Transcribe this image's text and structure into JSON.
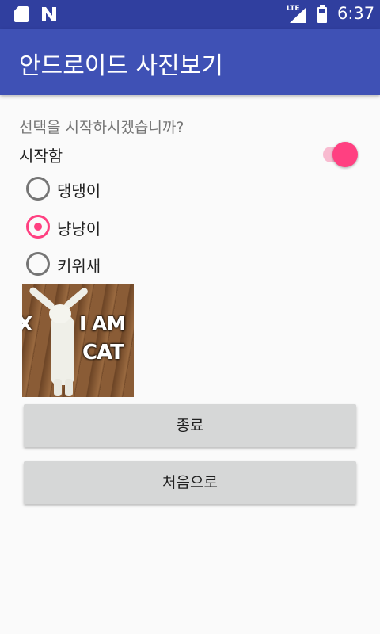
{
  "status_bar": {
    "time": "6:37",
    "network_label": "LTE",
    "icons": [
      "sd-card-icon",
      "n-notification-icon",
      "lte-signal-icon",
      "battery-icon"
    ]
  },
  "app_bar": {
    "title": "안드로이드 사진보기",
    "color": "#3f51b5",
    "status_color": "#303f9f"
  },
  "main": {
    "question": "선택을 시작하시겠습니까?",
    "switch": {
      "label": "시작함",
      "checked": true,
      "accent": "#ff4081"
    },
    "radio_options": [
      {
        "label": "댕댕이",
        "checked": false
      },
      {
        "label": "냥냥이",
        "checked": true
      },
      {
        "label": "키위새",
        "checked": false
      }
    ],
    "photo": {
      "caption_line1": "I AM",
      "caption_line2": "CAT",
      "caption_fragment": "X"
    },
    "buttons": {
      "exit_label": "종료",
      "reset_label": "처음으로"
    }
  }
}
